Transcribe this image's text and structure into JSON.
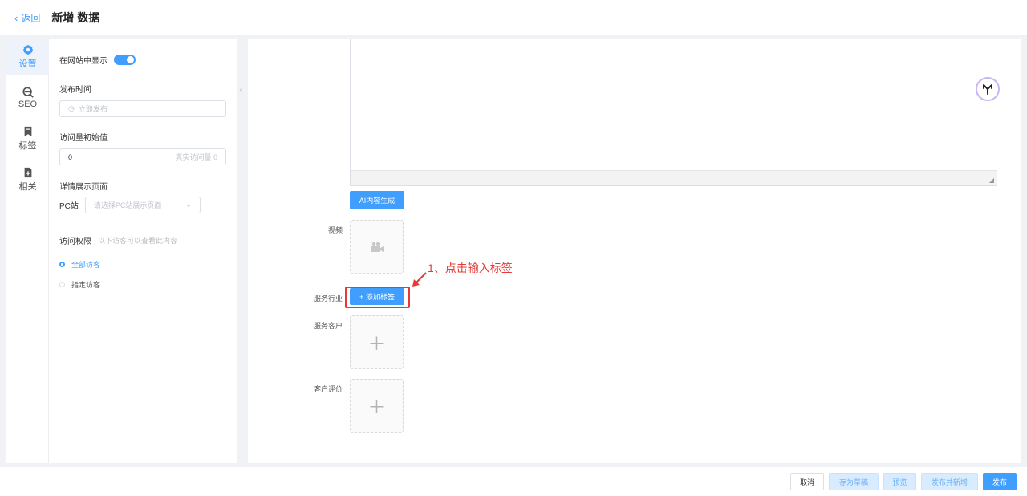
{
  "header": {
    "back_label": "返回",
    "title": "新增 数据"
  },
  "rail": [
    {
      "label": "设置",
      "icon": "gear-icon",
      "active": true
    },
    {
      "label": "SEO",
      "icon": "seo-icon",
      "active": false
    },
    {
      "label": "标签",
      "icon": "bookmark-icon",
      "active": false
    },
    {
      "label": "相关",
      "icon": "add-document-icon",
      "active": false
    }
  ],
  "settings": {
    "show_on_site_label": "在网站中显示",
    "show_on_site": true,
    "publish_time_label": "发布时间",
    "publish_time_placeholder": "立即发布",
    "initial_views_label": "访问量初始值",
    "initial_views_value": "0",
    "initial_views_hint": "真实访问量 0",
    "detail_page_label": "详情展示页面",
    "pc_site_label": "PC站",
    "pc_site_placeholder": "请选择PC站展示页面",
    "access_label": "访问权限",
    "access_hint": "以下访客可以查看此内容",
    "access_options": [
      "全部访客",
      "指定访客"
    ],
    "access_selected": "全部访客"
  },
  "main": {
    "ai_button": "AI内容生成",
    "video_label": "视频",
    "industry_label": "服务行业",
    "add_tag_button": "+ 添加标签",
    "clients_label": "服务客户",
    "reviews_label": "客户评价"
  },
  "annotation": {
    "text": "1、点击输入标签",
    "color": "#e53935"
  },
  "footer": {
    "cancel": "取消",
    "save_draft": "存为草稿",
    "preview": "预览",
    "publish_and_new": "发布并新增",
    "publish": "发布"
  },
  "colors": {
    "accent": "#409eff",
    "annotation": "#e53935"
  }
}
